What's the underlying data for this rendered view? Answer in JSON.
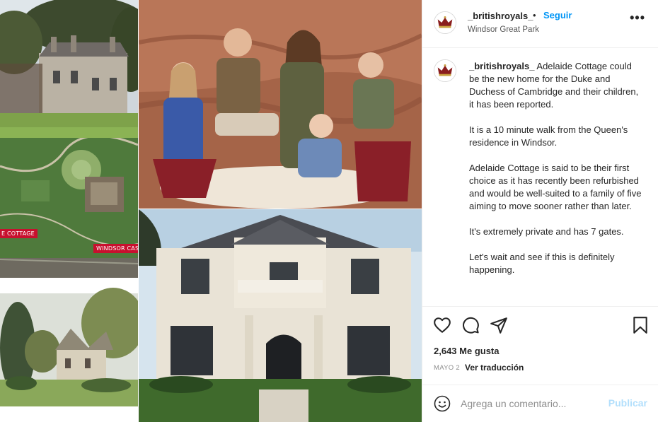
{
  "post": {
    "username": "_britishroyals_",
    "separator": "•",
    "follow_label": "Seguir",
    "location": "Windsor Great Park",
    "more_label": "•••"
  },
  "caption": {
    "username": "_britishroyals_",
    "paragraphs": [
      "Adelaide Cottage could be the new home for the Duke and Duchess of Cambridge and their children, it has been reported.",
      "It is a 10 minute walk from the Queen's residence in Windsor.",
      "Adelaide Cottage is said to be their first choice as it has recently been refurbished and would be well-suited to a family of five aiming to move sooner rather than later.",
      "It's extremely private and has 7 gates.",
      "Let's wait and see if this is definitely happening."
    ]
  },
  "icons": {
    "like": "heart-icon",
    "comment": "comment-icon",
    "share": "share-icon",
    "save": "bookmark-icon",
    "emoji": "emoji-icon",
    "options": "more-icon"
  },
  "engagement": {
    "likes": "2,643 Me gusta",
    "date": "MAYO 2",
    "translate": "Ver traducción"
  },
  "comment": {
    "placeholder": "Agrega un comentario...",
    "publish_label": "Publicar"
  },
  "map_labels": {
    "cottage": "E COTTAGE",
    "castle": "WINDSOR CASTLE"
  },
  "colors": {
    "link_blue": "#0095f6",
    "publish_disabled": "#b2dffc",
    "map_label_red": "#c8102e"
  }
}
